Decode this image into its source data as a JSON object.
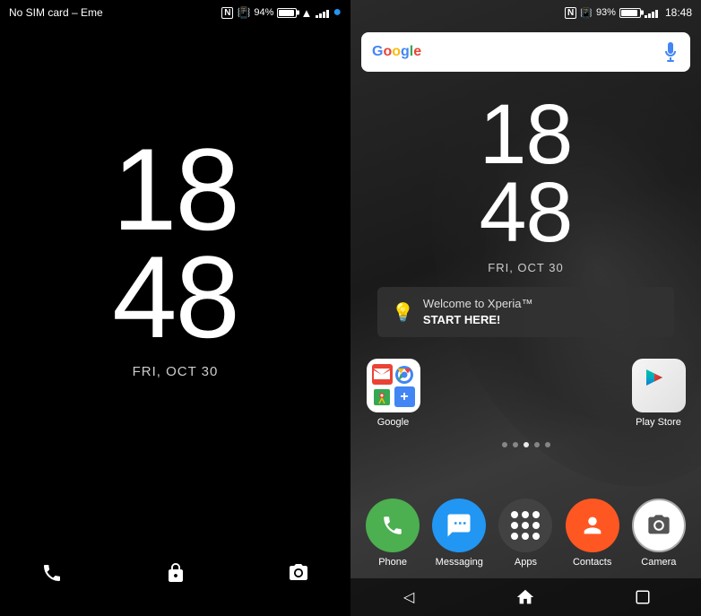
{
  "lockScreen": {
    "statusBar": {
      "carrier": "No SIM card – Eme",
      "batteryPercent": "94%",
      "icons": [
        "nfc",
        "vibrate",
        "battery",
        "wifi",
        "signal",
        "user"
      ]
    },
    "time": {
      "hour": "18",
      "minute": "48",
      "date": "FRI, OCT 30"
    },
    "bottomActions": {
      "phone": "📞",
      "lock": "🔒",
      "camera": "📷"
    }
  },
  "homeScreen": {
    "statusBar": {
      "time": "18:48",
      "batteryPercent": "93%",
      "icons": [
        "nfc",
        "vibrate",
        "battery",
        "wifi",
        "signal"
      ]
    },
    "searchBar": {
      "placeholder": "",
      "googleText": "Google",
      "micLabel": "mic"
    },
    "time": {
      "hour": "18",
      "minute": "48",
      "date": "FRI, OCT 30"
    },
    "welcomeBanner": {
      "text": "Welcome to Xperia™",
      "cta": "START HERE!"
    },
    "apps": [
      {
        "id": "google",
        "label": "Google",
        "type": "folder"
      },
      {
        "id": "play-store",
        "label": "Play Store",
        "type": "play"
      }
    ],
    "pageDots": [
      false,
      false,
      true,
      false,
      false
    ],
    "dock": [
      {
        "id": "phone",
        "label": "Phone",
        "type": "phone"
      },
      {
        "id": "messaging",
        "label": "Messaging",
        "type": "messaging"
      },
      {
        "id": "apps",
        "label": "Apps",
        "type": "apps"
      },
      {
        "id": "contacts",
        "label": "Contacts",
        "type": "contacts"
      },
      {
        "id": "camera",
        "label": "Camera",
        "type": "camera"
      }
    ],
    "navBar": {
      "back": "◁",
      "home": "⌂",
      "recents": "▭"
    }
  }
}
